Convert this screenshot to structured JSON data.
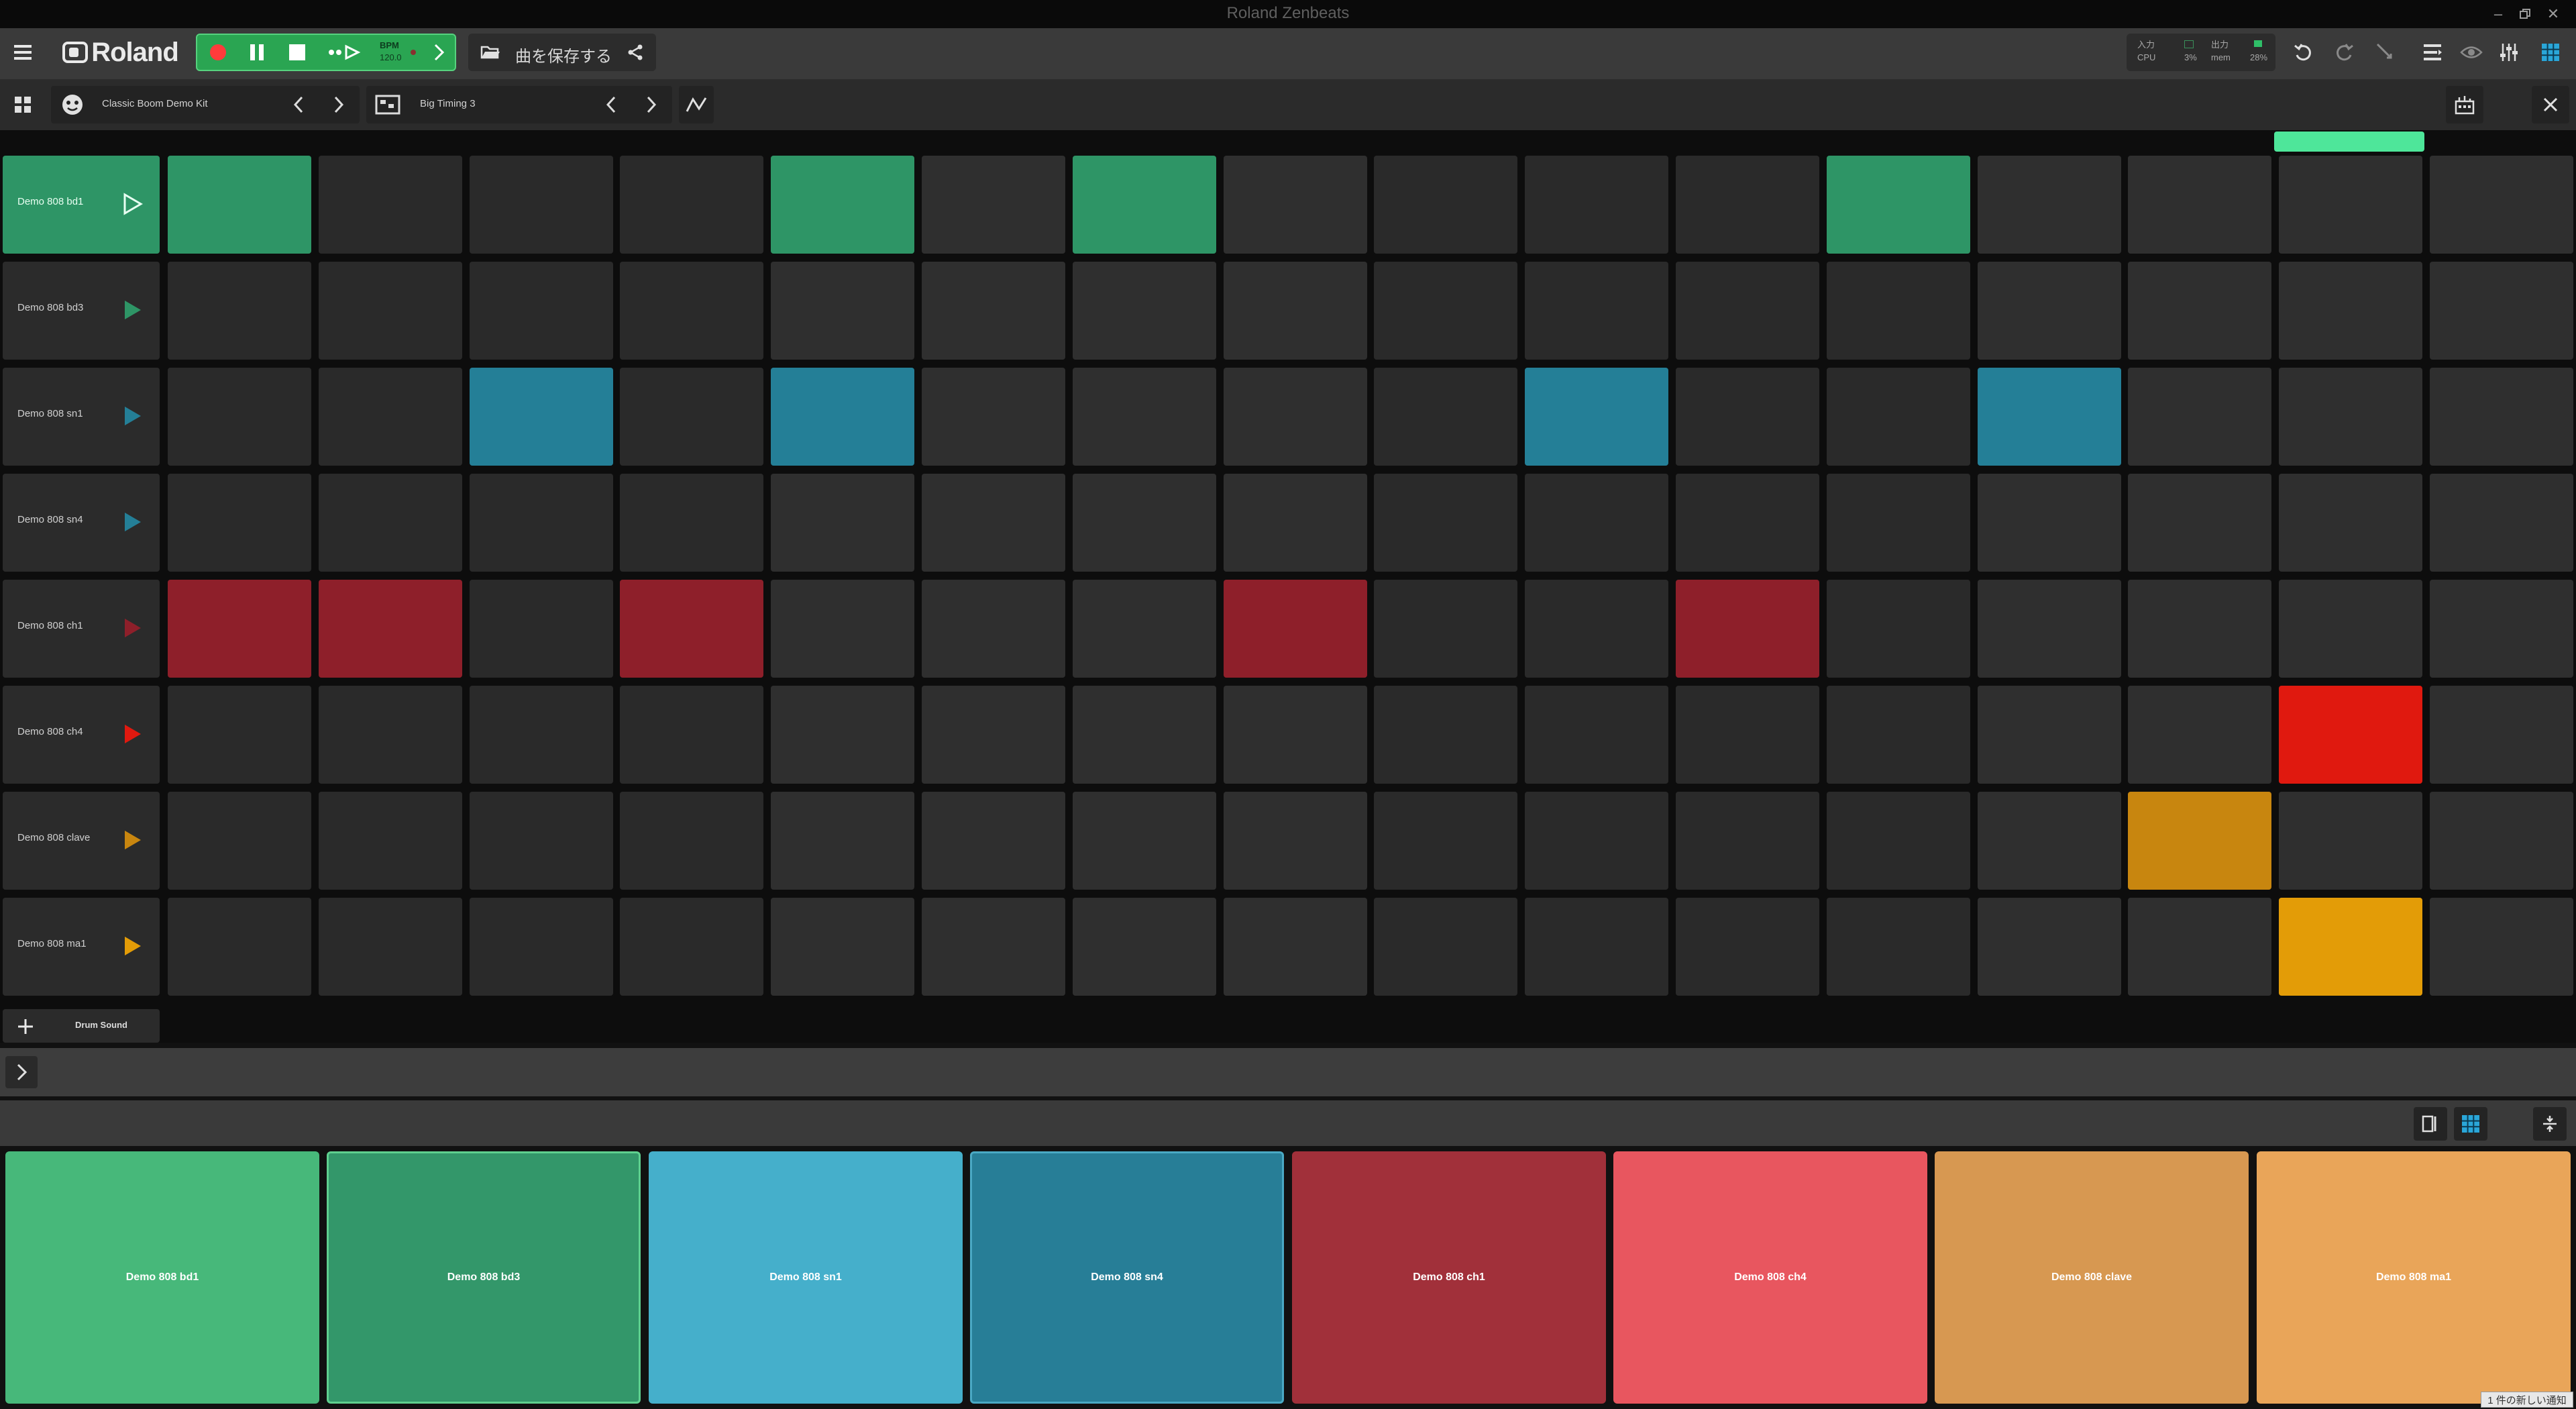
{
  "window": {
    "title": "Roland Zenbeats"
  },
  "toolbar": {
    "logo": "Roland",
    "bpm_label": "BPM",
    "bpm_value": "120.0",
    "save_label": "曲を保存する",
    "meters": {
      "in_label": "入力",
      "cpu_label": "CPU",
      "cpu_value": "3%",
      "out_label": "出力",
      "mem_label": "mem",
      "mem_value": "28%"
    }
  },
  "kit": {
    "kit_name": "Classic Boom Demo Kit",
    "pattern_name": "Big Timing 3"
  },
  "tracks": [
    {
      "name": "Demo 808 bd1",
      "color": "#2e9566",
      "selected": true
    },
    {
      "name": "Demo 808 bd3",
      "color": "#2e9566"
    },
    {
      "name": "Demo 808 sn1",
      "color": "#247f97"
    },
    {
      "name": "Demo 808 sn4",
      "color": "#247f97"
    },
    {
      "name": "Demo 808 ch1",
      "color": "#8e1f2a"
    },
    {
      "name": "Demo 808 ch4",
      "color": "#e0190f"
    },
    {
      "name": "Demo 808 clave",
      "color": "#c8860f"
    },
    {
      "name": "Demo 808 ma1",
      "color": "#e39c07"
    }
  ],
  "steps": [
    [
      1,
      0,
      0,
      0,
      1,
      0,
      1,
      0,
      0,
      0,
      0,
      1,
      0,
      0,
      0,
      0
    ],
    [
      0,
      0,
      0,
      0,
      0,
      0,
      0,
      0,
      0,
      0,
      0,
      0,
      0,
      0,
      0,
      0
    ],
    [
      0,
      0,
      1,
      0,
      1,
      0,
      0,
      0,
      0,
      1,
      0,
      0,
      1,
      0,
      0,
      0
    ],
    [
      0,
      0,
      0,
      0,
      0,
      0,
      0,
      0,
      0,
      0,
      0,
      0,
      0,
      0,
      0,
      0
    ],
    [
      1,
      1,
      0,
      1,
      0,
      0,
      0,
      1,
      0,
      0,
      1,
      0,
      0,
      0,
      0,
      0
    ],
    [
      0,
      0,
      0,
      0,
      0,
      0,
      0,
      0,
      0,
      0,
      0,
      0,
      0,
      0,
      1,
      0
    ],
    [
      0,
      0,
      0,
      0,
      0,
      0,
      0,
      0,
      0,
      0,
      0,
      0,
      0,
      1,
      0,
      0
    ],
    [
      0,
      0,
      0,
      0,
      0,
      0,
      0,
      0,
      0,
      0,
      0,
      0,
      0,
      0,
      1,
      0
    ]
  ],
  "add_sound_label": "Drum Sound",
  "pads": [
    {
      "name": "Demo 808 bd1",
      "color": "#47b87a"
    },
    {
      "name": "Demo 808 bd3",
      "color": "#33976a",
      "border": "#5fd08f"
    },
    {
      "name": "Demo 808 sn1",
      "color": "#45afcb"
    },
    {
      "name": "Demo 808 sn4",
      "color": "#277e97",
      "border": "#4aa9c4"
    },
    {
      "name": "Demo 808 ch1",
      "color": "#a1303a"
    },
    {
      "name": "Demo 808 ch4",
      "color": "#e8565f"
    },
    {
      "name": "Demo 808 clave",
      "color": "#d79851"
    },
    {
      "name": "Demo 808 ma1",
      "color": "#e9a559"
    }
  ],
  "notification": "1 件の新しい通知"
}
